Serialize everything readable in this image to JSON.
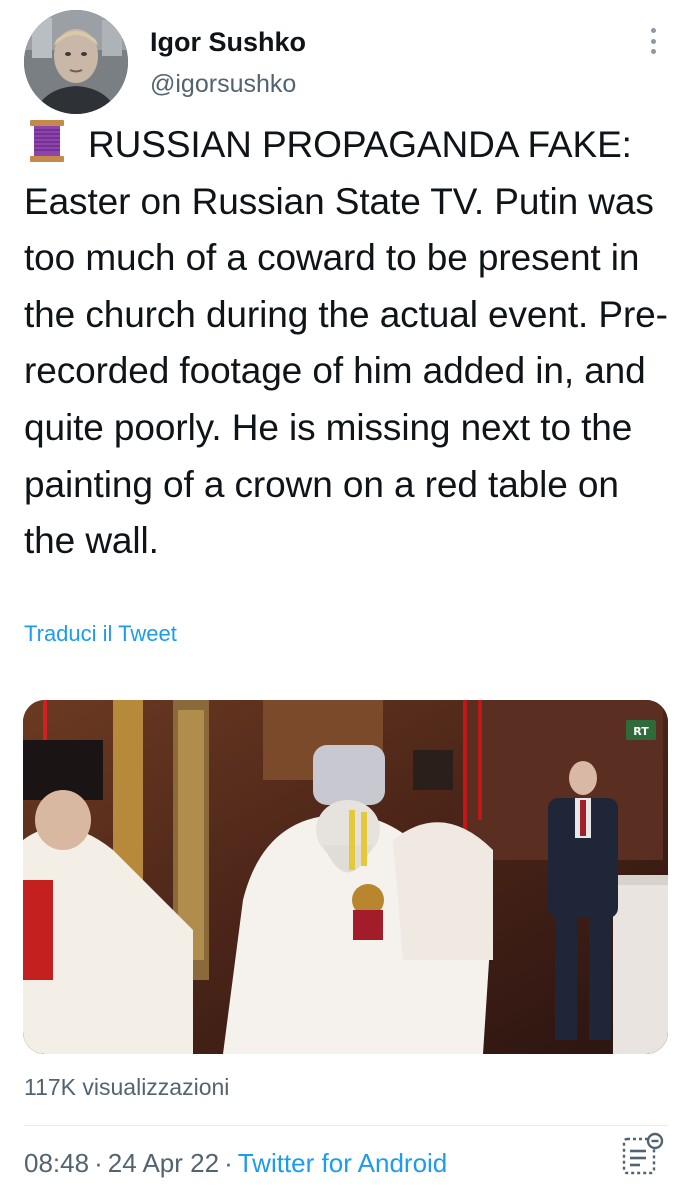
{
  "author": {
    "name": "Igor Sushko",
    "handle": "@igorsushko",
    "avatar_icon": "profile-photo"
  },
  "tweet": {
    "emoji_icon": "thread-spool-icon",
    "text": "RUSSIAN PROPAGANDA FAKE: Easter on Russian State TV. Putin was too much of a coward to be present in the church during the actual event. Pre-recorded footage of him added in, and quite poorly. He is missing next to the painting of a crown on a red table on the wall.",
    "translate_label": "Traduci il Tweet"
  },
  "media": {
    "watermark": "RT",
    "description_icon": "video-frame"
  },
  "views": "117K visualizzazioni",
  "meta": {
    "time": "08:48",
    "separator": "·",
    "date": "24 Apr 22",
    "source": "Twitter for Android"
  },
  "colors": {
    "link": "#1d9bf0",
    "secondary_text": "#536471",
    "primary_text": "#0f1419"
  }
}
